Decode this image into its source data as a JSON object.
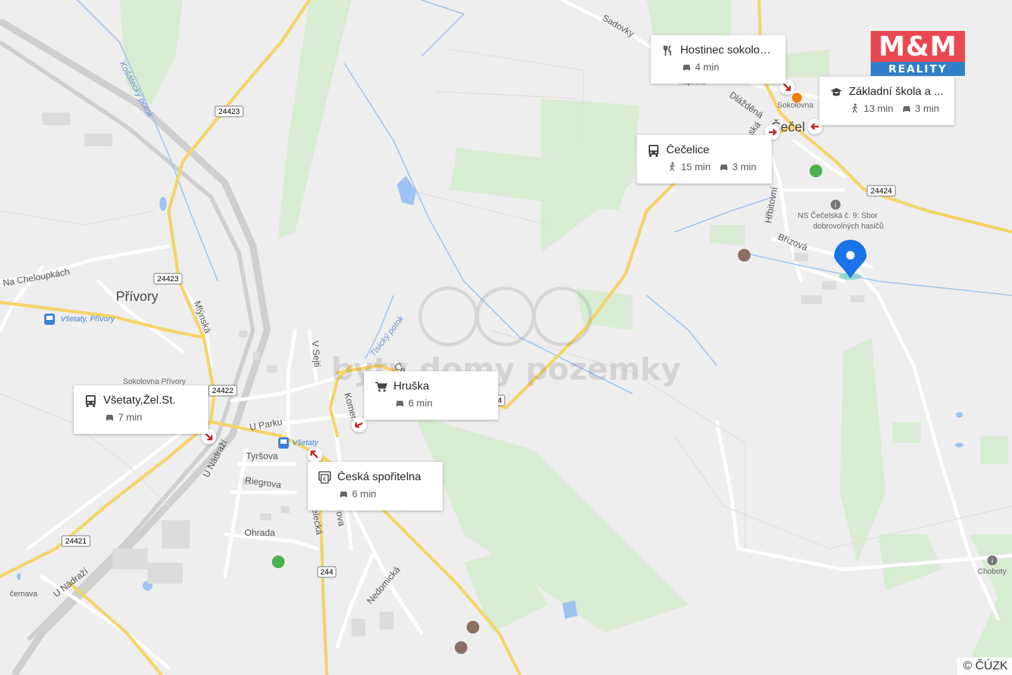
{
  "map": {
    "town_labels": {
      "privory": "Přívory",
      "cecelice": "Čečel",
      "na_cheloupkach": "Na Cheloupkách"
    },
    "road_labels": {
      "r24423_top": "24423",
      "r24423_mid": "24423",
      "r24422": "24422",
      "r24421": "24421",
      "r244": "244",
      "r24424": "24424",
      "r24_partial": "4"
    },
    "street_labels": {
      "u_parku": "U Parku",
      "tyrsova": "Tyršova",
      "riegrova": "Riegrova",
      "ohrada": "Ohrada",
      "u_nadrazi_1": "U Nádraží",
      "u_nadrazi_2": "U Nádraží",
      "mlynska": "Mlýnská",
      "v_sejti": "V Sejti",
      "komenskeho": "Komen",
      "nedomicka": "Nedomická",
      "hrbitovni": "Hřbitovní",
      "brizova": "Břízová",
      "sadovky": "Sadovky",
      "dlazdena": "Dlážděná",
      "ska": "ská",
      "kaplicka": "Kaplička",
      "celakovicka": "elecká",
      "rova": "rova",
      "cernava": "černava",
      "ce": "Če"
    },
    "poi_labels": {
      "sokolovna_privory": "Sokolovna Přívory",
      "vsetaty_privory_stop": "Všetaty, Přívory",
      "vsetaty_stop": "Všetaty",
      "sokolovna_cec": "Sokolovna",
      "ns_line1": "NS Čečelská č. 9: Sbor",
      "ns_line2": "dobrovolných hasičů",
      "choboty": "Choboty"
    },
    "water_labels": {
      "kostecky": "Košátecký potok",
      "tisicky": "Tisícký potok"
    },
    "watermark": "byty domy pozemky"
  },
  "cards": [
    {
      "id": "hostinec",
      "icon": "restaurant-icon",
      "name": "Hostinec sokolovna",
      "times": [
        {
          "mode": "car",
          "text": "4 min"
        }
      ]
    },
    {
      "id": "skola",
      "icon": "school-icon",
      "name": "Základní škola a ...",
      "times": [
        {
          "mode": "walk",
          "text": "13 min"
        },
        {
          "mode": "car",
          "text": "3 min"
        }
      ]
    },
    {
      "id": "cecelice",
      "icon": "bus-icon",
      "name": "Čečelice",
      "times": [
        {
          "mode": "walk",
          "text": "15 min"
        },
        {
          "mode": "car",
          "text": "3 min"
        }
      ]
    },
    {
      "id": "hruska",
      "icon": "cart-icon",
      "name": "Hruška",
      "times": [
        {
          "mode": "car",
          "text": "6 min"
        }
      ]
    },
    {
      "id": "vsetaty",
      "icon": "bus-icon",
      "name": "Všetaty,Žel.St.",
      "times": [
        {
          "mode": "car",
          "text": "7 min"
        }
      ]
    },
    {
      "id": "sporitelna",
      "icon": "atm-icon",
      "name": "Česká spořitelna",
      "times": [
        {
          "mode": "car",
          "text": "6 min"
        }
      ]
    }
  ],
  "logo": {
    "top": "M&M",
    "bottom": "REALITY"
  },
  "copyright": "© ČÚZK",
  "colors": {
    "road_major": "#f6d46a",
    "road_minor": "#ffffff",
    "water": "#8ab4f8",
    "green": "#d5ead1",
    "pin": "#1a73e8",
    "arrow": "#c5221f"
  }
}
